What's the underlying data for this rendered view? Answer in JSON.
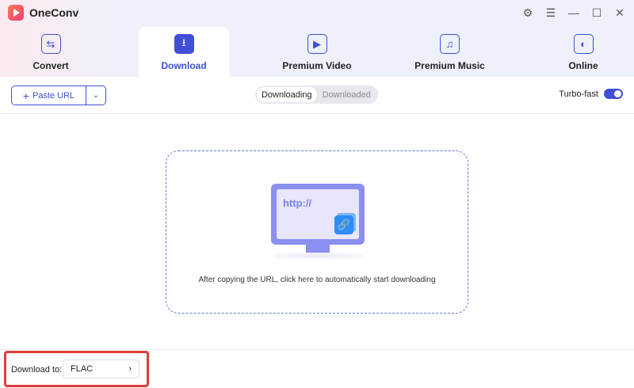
{
  "app": {
    "title": "OneConv"
  },
  "window_controls": [
    "settings-icon",
    "menu-icon",
    "minimize-icon",
    "maximize-icon",
    "close-icon"
  ],
  "tabs": [
    {
      "label": "Convert",
      "icon": "convert-arrows-icon"
    },
    {
      "label": "Download",
      "icon": "download-icon",
      "active": true
    },
    {
      "label": "Premium Video",
      "icon": "play-icon"
    },
    {
      "label": "Premium Music",
      "icon": "music-note-icon"
    },
    {
      "label": "Online",
      "icon": "compass-icon"
    }
  ],
  "toolbar": {
    "paste_label": "Paste URL",
    "segments": [
      "Downloading",
      "Downloaded"
    ],
    "active_segment": "Downloading",
    "turbo_label": "Turbo-fast",
    "turbo_on": true
  },
  "dropzone": {
    "screen_text": "http://",
    "hint": "After copying the URL, click here to automatically start downloading"
  },
  "footer": {
    "download_to_label": "Download to:",
    "format": "FLAC"
  },
  "colors": {
    "accent": "#3f4fd6",
    "highlight": "#e03c3c"
  }
}
